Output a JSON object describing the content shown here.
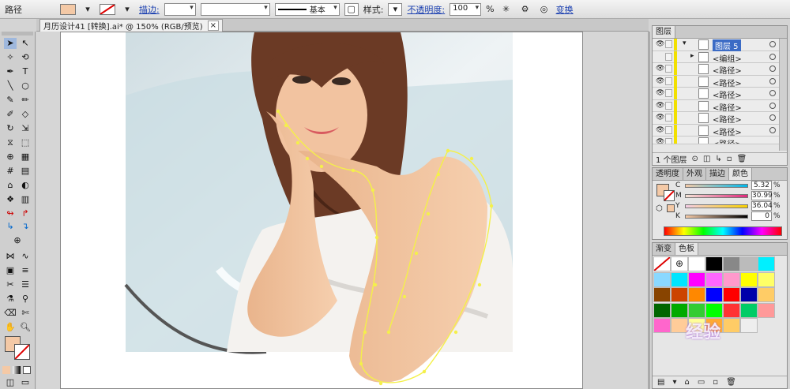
{
  "control_bar": {
    "object_type": "路径",
    "stroke_label": "描边:",
    "stroke_profile": "基本",
    "style_label": "样式:",
    "opacity_label": "不透明度:",
    "opacity_value": "100",
    "opacity_unit": "%",
    "transform_label": "变换",
    "fill_color": "#f4c9a6"
  },
  "document": {
    "tab_title": "月历设计41 [转换].ai* @ 150% (RGB/预览)",
    "close": "×"
  },
  "layers_panel": {
    "title": "图层",
    "rows": [
      {
        "label": "图层 5",
        "indent": 0,
        "expanded": true
      },
      {
        "label": "<编组>",
        "indent": 1
      },
      {
        "label": "<路径>",
        "indent": 1
      },
      {
        "label": "<路径>",
        "indent": 1
      },
      {
        "label": "<路径>",
        "indent": 1
      },
      {
        "label": "<路径>",
        "indent": 1
      },
      {
        "label": "<路径>",
        "indent": 1
      },
      {
        "label": "<路径>",
        "indent": 1
      },
      {
        "label": "<路径>",
        "indent": 1
      }
    ],
    "layer_count": "1 个图层"
  },
  "color_panel": {
    "tabs": [
      "透明度",
      "外观",
      "描边",
      "颜色"
    ],
    "active_tab": "颜色",
    "channels": [
      {
        "name": "C",
        "value": "5.32",
        "unit": "%"
      },
      {
        "name": "M",
        "value": "30.99",
        "unit": "%"
      },
      {
        "name": "Y",
        "value": "36.04",
        "unit": "%"
      },
      {
        "name": "K",
        "value": "0",
        "unit": "%"
      }
    ],
    "fill_color": "#f4c9a6"
  },
  "swatches_panel": {
    "tabs": [
      "渐变",
      "色板"
    ],
    "active_tab": "色板",
    "colors": [
      "#ffffff",
      "#000000",
      "#888888",
      "#bbbbbb",
      "#00f0ff",
      "#8ad8ff",
      "#00e5ff",
      "#ff00ff",
      "#ff66ff",
      "#ff99cc",
      "#ffff00",
      "#ffff66",
      "#884400",
      "#cc4400",
      "#ff8800",
      "#0000ff",
      "#ff0000",
      "#0000aa",
      "#ffcc66",
      "#006600",
      "#00aa00",
      "#33cc33",
      "#00ff00",
      "#ff3333",
      "#00cc66",
      "#ff9999",
      "#ff66cc",
      "#ffcc99",
      "#ffff99",
      "#ffaa33",
      "#ffcc66",
      "#eeeeee"
    ]
  },
  "watermark": "经验"
}
